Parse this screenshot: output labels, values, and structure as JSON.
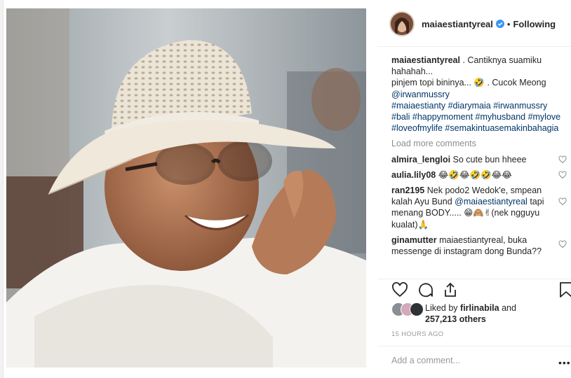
{
  "header": {
    "username": "maiaestiantyreal",
    "separator": "•",
    "follow_label": "Following"
  },
  "caption": {
    "username": "maiaestiantyreal",
    "text1": ". Cantiknya suamiku hahahah...",
    "text2": "pinjem topi bininya... 🤣 . Cucok Meong",
    "mention": "@irwanmussry",
    "hashtags": "#maiaestianty #diarymaia #irwanmussry #bali #happymoment #myhusband #mylove #loveofmylife #semakintuasemakinbahagia"
  },
  "load_more": "Load more comments",
  "comments": [
    {
      "user": "almira_lengloi",
      "pre": "So cute bun hheee",
      "mention": "",
      "post": ""
    },
    {
      "user": "aulia.lily08",
      "pre": "😂🤣😂🤣🤣😂😂",
      "mention": "",
      "post": ""
    },
    {
      "user": "ran2195",
      "pre": "Nek podo2 Wedok'e, smpean kalah Ayu Bund ",
      "mention": "@maiaestiantyreal",
      "post": " tapi menang BODY..... 😁🙈✌(nek ngguyu kualat)🙏"
    },
    {
      "user": "ginamutter",
      "pre": "maiaestiantyreal, buka messenge di instagram dong Bunda??",
      "mention": "",
      "post": ""
    }
  ],
  "likes": {
    "prefix": "Liked by ",
    "user": "firlinabila",
    "and": " and",
    "count": "257,213 others"
  },
  "timestamp": "15 HOURS AGO",
  "add_comment_placeholder": "Add a comment...",
  "options_icon": "•••",
  "colors": {
    "link": "#003569",
    "verified": "#3897f0",
    "muted": "#8e8e8e"
  }
}
